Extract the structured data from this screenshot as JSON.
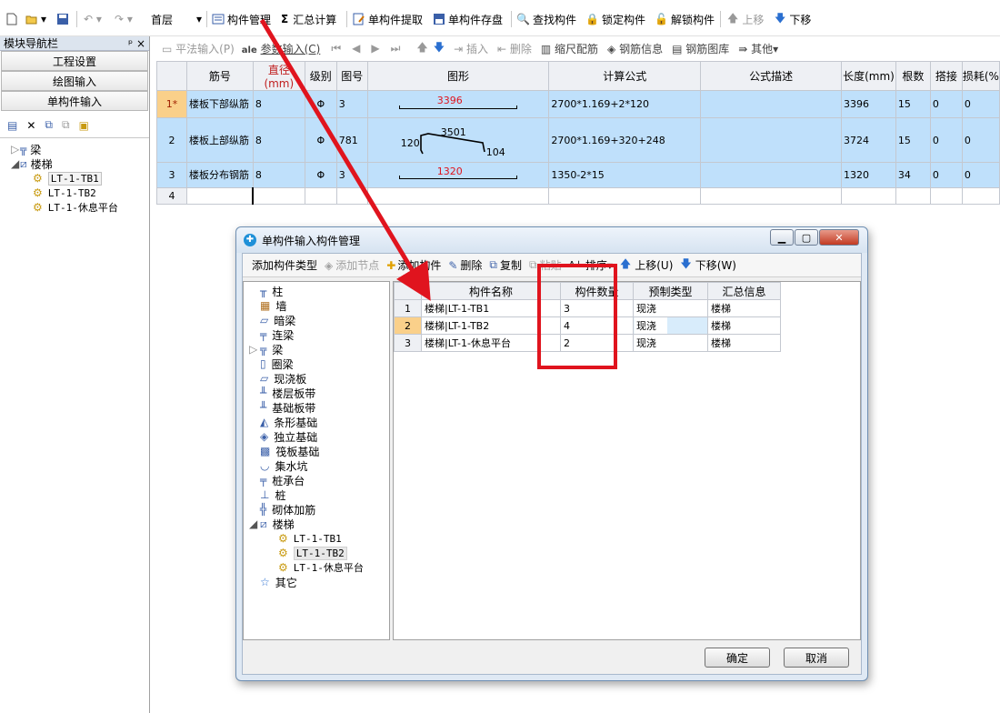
{
  "toolbar": {
    "floor": "首层",
    "items": [
      "构件管理",
      "汇总计算",
      "单构件提取",
      "单构件存盘",
      "查找构件",
      "锁定构件",
      "解锁构件",
      "上移",
      "下移"
    ]
  },
  "nav": {
    "title": "模块导航栏",
    "pin": "ᵖ ×",
    "buttons": [
      "工程设置",
      "绘图输入",
      "单构件输入"
    ],
    "tree": [
      "梁",
      "楼梯",
      "LT-1-TB1",
      "LT-1-TB2",
      "LT-1-休息平台"
    ]
  },
  "subtoolbar": [
    "平法输入(P)",
    "参数输入(C)",
    "插入",
    "删除",
    "缩尺配筋",
    "钢筋信息",
    "钢筋图库",
    "其他"
  ],
  "grid": {
    "headers": [
      "筋号",
      "直径(mm)",
      "级别",
      "图号",
      "图形",
      "计算公式",
      "公式描述",
      "长度(mm)",
      "根数",
      "搭接",
      "损耗(%"
    ],
    "rows": [
      {
        "rn": "1*",
        "name": "楼板下部纵筋",
        "dia": "8",
        "grade": "Φ",
        "fig": "3",
        "shape_label": "3396",
        "formula": "2700*1.169+2*120",
        "desc": "",
        "len": "3396",
        "count": "15",
        "lap": "0",
        "loss": "0"
      },
      {
        "rn": "2",
        "name": "楼板上部纵筋",
        "dia": "8",
        "grade": "Φ",
        "fig": "781",
        "shape_label": "3501",
        "shape_left": "120",
        "shape_right": "104",
        "formula": "2700*1.169+320+248",
        "desc": "",
        "len": "3724",
        "count": "15",
        "lap": "0",
        "loss": "0"
      },
      {
        "rn": "3",
        "name": "楼板分布钢筋",
        "dia": "8",
        "grade": "Φ",
        "fig": "3",
        "shape_label": "1320",
        "formula": "1350-2*15",
        "desc": "",
        "len": "1320",
        "count": "34",
        "lap": "0",
        "loss": "0"
      },
      {
        "rn": "4"
      }
    ]
  },
  "dialog": {
    "title": "单构件输入构件管理",
    "toolbar": [
      "添加构件类型",
      "添加节点",
      "添加构件",
      "删除",
      "复制",
      "粘贴",
      "排序",
      "上移(U)",
      "下移(W)"
    ],
    "tree": [
      "柱",
      "墙",
      "暗梁",
      "连梁",
      "梁",
      "圈梁",
      "现浇板",
      "楼层板带",
      "基础板带",
      "条形基础",
      "独立基础",
      "筏板基础",
      "集水坑",
      "桩承台",
      "桩",
      "砌体加筋",
      "楼梯",
      "LT-1-TB1",
      "LT-1-TB2",
      "LT-1-休息平台",
      "其它"
    ],
    "headers": [
      "构件名称",
      "构件数量",
      "预制类型",
      "汇总信息"
    ],
    "rows": [
      {
        "rn": "1",
        "name": "楼梯|LT-1-TB1",
        "qty": "3",
        "type": "现浇",
        "sum": "楼梯"
      },
      {
        "rn": "2",
        "name": "楼梯|LT-1-TB2",
        "qty": "4",
        "type": "现浇",
        "sum": "楼梯"
      },
      {
        "rn": "3",
        "name": "楼梯|LT-1-休息平台",
        "qty": "2",
        "type": "现浇",
        "sum": "楼梯"
      }
    ],
    "ok": "确定",
    "cancel": "取消"
  },
  "colors": {
    "selected_row": "#bfe0fb",
    "annotation": "#e0141e",
    "rebar_label": "#e0141e"
  }
}
